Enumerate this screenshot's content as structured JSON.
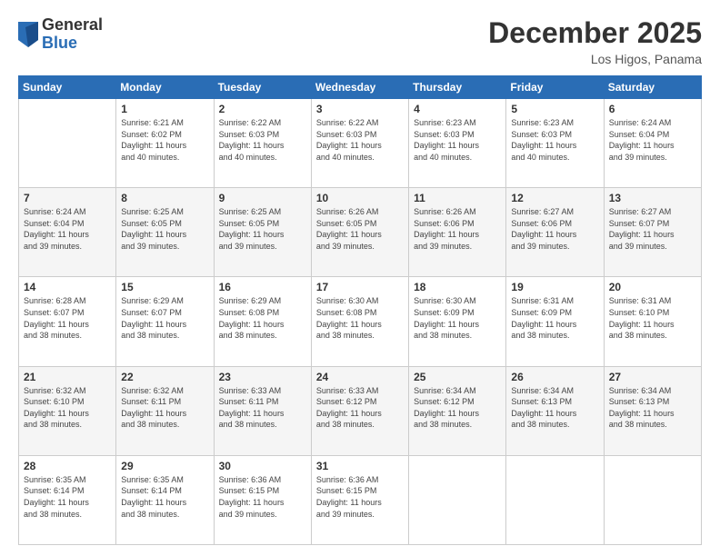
{
  "header": {
    "logo_general": "General",
    "logo_blue": "Blue",
    "month_title": "December 2025",
    "location": "Los Higos, Panama"
  },
  "days_of_week": [
    "Sunday",
    "Monday",
    "Tuesday",
    "Wednesday",
    "Thursday",
    "Friday",
    "Saturday"
  ],
  "weeks": [
    [
      {
        "day": "",
        "info": ""
      },
      {
        "day": "1",
        "info": "Sunrise: 6:21 AM\nSunset: 6:02 PM\nDaylight: 11 hours\nand 40 minutes."
      },
      {
        "day": "2",
        "info": "Sunrise: 6:22 AM\nSunset: 6:03 PM\nDaylight: 11 hours\nand 40 minutes."
      },
      {
        "day": "3",
        "info": "Sunrise: 6:22 AM\nSunset: 6:03 PM\nDaylight: 11 hours\nand 40 minutes."
      },
      {
        "day": "4",
        "info": "Sunrise: 6:23 AM\nSunset: 6:03 PM\nDaylight: 11 hours\nand 40 minutes."
      },
      {
        "day": "5",
        "info": "Sunrise: 6:23 AM\nSunset: 6:03 PM\nDaylight: 11 hours\nand 40 minutes."
      },
      {
        "day": "6",
        "info": "Sunrise: 6:24 AM\nSunset: 6:04 PM\nDaylight: 11 hours\nand 39 minutes."
      }
    ],
    [
      {
        "day": "7",
        "info": "Sunrise: 6:24 AM\nSunset: 6:04 PM\nDaylight: 11 hours\nand 39 minutes."
      },
      {
        "day": "8",
        "info": "Sunrise: 6:25 AM\nSunset: 6:05 PM\nDaylight: 11 hours\nand 39 minutes."
      },
      {
        "day": "9",
        "info": "Sunrise: 6:25 AM\nSunset: 6:05 PM\nDaylight: 11 hours\nand 39 minutes."
      },
      {
        "day": "10",
        "info": "Sunrise: 6:26 AM\nSunset: 6:05 PM\nDaylight: 11 hours\nand 39 minutes."
      },
      {
        "day": "11",
        "info": "Sunrise: 6:26 AM\nSunset: 6:06 PM\nDaylight: 11 hours\nand 39 minutes."
      },
      {
        "day": "12",
        "info": "Sunrise: 6:27 AM\nSunset: 6:06 PM\nDaylight: 11 hours\nand 39 minutes."
      },
      {
        "day": "13",
        "info": "Sunrise: 6:27 AM\nSunset: 6:07 PM\nDaylight: 11 hours\nand 39 minutes."
      }
    ],
    [
      {
        "day": "14",
        "info": "Sunrise: 6:28 AM\nSunset: 6:07 PM\nDaylight: 11 hours\nand 38 minutes."
      },
      {
        "day": "15",
        "info": "Sunrise: 6:29 AM\nSunset: 6:07 PM\nDaylight: 11 hours\nand 38 minutes."
      },
      {
        "day": "16",
        "info": "Sunrise: 6:29 AM\nSunset: 6:08 PM\nDaylight: 11 hours\nand 38 minutes."
      },
      {
        "day": "17",
        "info": "Sunrise: 6:30 AM\nSunset: 6:08 PM\nDaylight: 11 hours\nand 38 minutes."
      },
      {
        "day": "18",
        "info": "Sunrise: 6:30 AM\nSunset: 6:09 PM\nDaylight: 11 hours\nand 38 minutes."
      },
      {
        "day": "19",
        "info": "Sunrise: 6:31 AM\nSunset: 6:09 PM\nDaylight: 11 hours\nand 38 minutes."
      },
      {
        "day": "20",
        "info": "Sunrise: 6:31 AM\nSunset: 6:10 PM\nDaylight: 11 hours\nand 38 minutes."
      }
    ],
    [
      {
        "day": "21",
        "info": "Sunrise: 6:32 AM\nSunset: 6:10 PM\nDaylight: 11 hours\nand 38 minutes."
      },
      {
        "day": "22",
        "info": "Sunrise: 6:32 AM\nSunset: 6:11 PM\nDaylight: 11 hours\nand 38 minutes."
      },
      {
        "day": "23",
        "info": "Sunrise: 6:33 AM\nSunset: 6:11 PM\nDaylight: 11 hours\nand 38 minutes."
      },
      {
        "day": "24",
        "info": "Sunrise: 6:33 AM\nSunset: 6:12 PM\nDaylight: 11 hours\nand 38 minutes."
      },
      {
        "day": "25",
        "info": "Sunrise: 6:34 AM\nSunset: 6:12 PM\nDaylight: 11 hours\nand 38 minutes."
      },
      {
        "day": "26",
        "info": "Sunrise: 6:34 AM\nSunset: 6:13 PM\nDaylight: 11 hours\nand 38 minutes."
      },
      {
        "day": "27",
        "info": "Sunrise: 6:34 AM\nSunset: 6:13 PM\nDaylight: 11 hours\nand 38 minutes."
      }
    ],
    [
      {
        "day": "28",
        "info": "Sunrise: 6:35 AM\nSunset: 6:14 PM\nDaylight: 11 hours\nand 38 minutes."
      },
      {
        "day": "29",
        "info": "Sunrise: 6:35 AM\nSunset: 6:14 PM\nDaylight: 11 hours\nand 38 minutes."
      },
      {
        "day": "30",
        "info": "Sunrise: 6:36 AM\nSunset: 6:15 PM\nDaylight: 11 hours\nand 39 minutes."
      },
      {
        "day": "31",
        "info": "Sunrise: 6:36 AM\nSunset: 6:15 PM\nDaylight: 11 hours\nand 39 minutes."
      },
      {
        "day": "",
        "info": ""
      },
      {
        "day": "",
        "info": ""
      },
      {
        "day": "",
        "info": ""
      }
    ]
  ]
}
